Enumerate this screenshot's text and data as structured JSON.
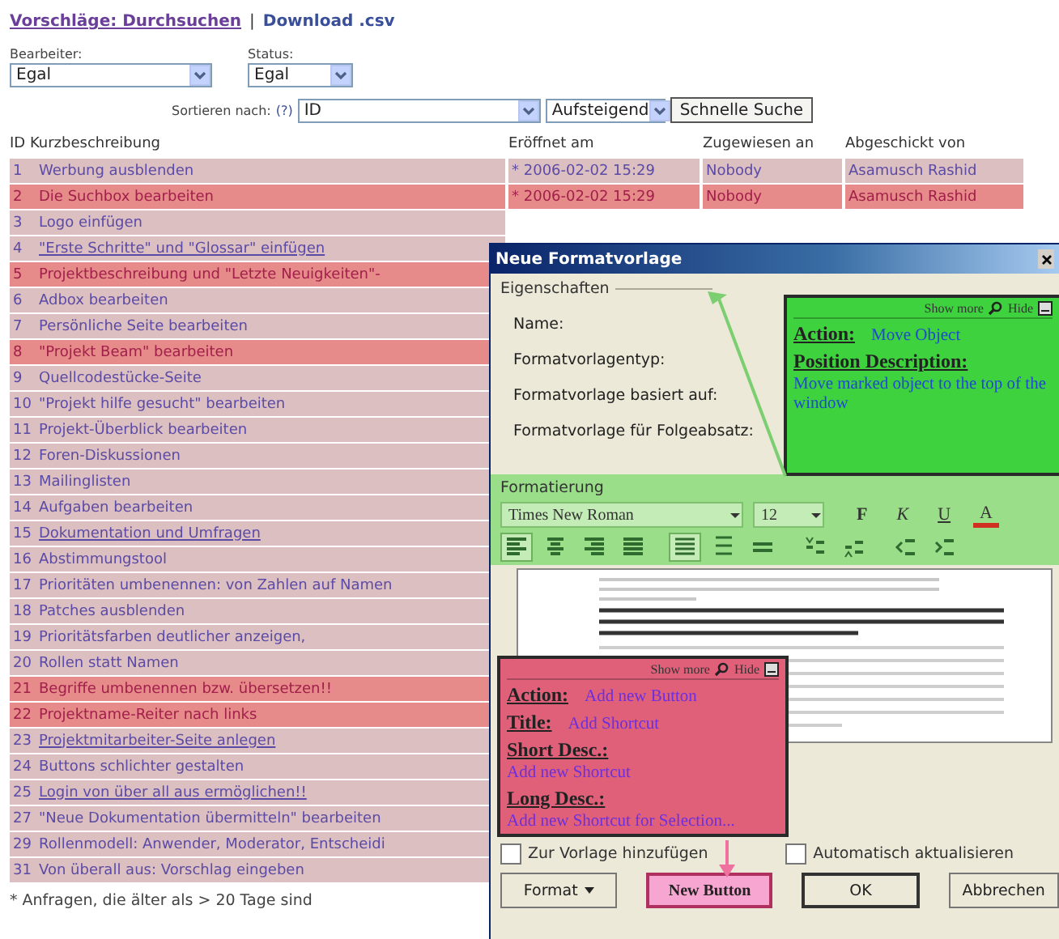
{
  "header": {
    "links": [
      {
        "label": "Vorschläge: Durchsuchen",
        "visited": true
      },
      {
        "label": "Download .csv",
        "visited": false
      }
    ],
    "separator": "|"
  },
  "filters": [
    {
      "label": "Bearbeiter:",
      "value": "Egal",
      "wide": true
    },
    {
      "label": "Status:",
      "value": "Egal",
      "wide": false
    }
  ],
  "sort": {
    "label": "Sortieren nach:",
    "help": "(?)",
    "field": "ID",
    "order": "Aufsteigend",
    "button": "Schnelle Suche"
  },
  "table": {
    "columns": [
      "ID",
      "Kurzbeschreibung",
      "Eröffnet am",
      "Zugewiesen an",
      "Abgeschickt von"
    ],
    "rows": [
      {
        "id": "1",
        "summary": "Werbung ausblenden",
        "opened": "* 2006-02-02 15:29",
        "assigned": "Nobody",
        "submitted_by": "Asamusch Rashid",
        "highlighted": false,
        "visited": false
      },
      {
        "id": "2",
        "summary": "Die Suchbox bearbeiten",
        "opened": "* 2006-02-02 15:29",
        "assigned": "Nobody",
        "submitted_by": "Asamusch Rashid",
        "highlighted": true,
        "visited": false
      },
      {
        "id": "3",
        "summary": "Logo einfügen",
        "highlighted": false,
        "visited": false
      },
      {
        "id": "4",
        "summary": "\"Erste Schritte\" und \"Glossar\" einfügen",
        "highlighted": false,
        "visited": true
      },
      {
        "id": "5",
        "summary": "Projektbeschreibung und \"Letzte Neuigkeiten\"-",
        "highlighted": true,
        "visited": false
      },
      {
        "id": "6",
        "summary": "Adbox bearbeiten",
        "highlighted": false,
        "visited": false
      },
      {
        "id": "7",
        "summary": "Persönliche Seite bearbeiten",
        "highlighted": false,
        "visited": false
      },
      {
        "id": "8",
        "summary": "\"Projekt Beam\" bearbeiten",
        "highlighted": true,
        "visited": false
      },
      {
        "id": "9",
        "summary": "Quellcodestücke-Seite",
        "highlighted": false,
        "visited": false
      },
      {
        "id": "10",
        "summary": "\"Projekt hilfe gesucht\" bearbeiten",
        "highlighted": false,
        "visited": false
      },
      {
        "id": "11",
        "summary": "Projekt-Überblick bearbeiten",
        "highlighted": false,
        "visited": false
      },
      {
        "id": "12",
        "summary": "Foren-Diskussionen",
        "highlighted": false,
        "visited": false
      },
      {
        "id": "13",
        "summary": "Mailinglisten",
        "highlighted": false,
        "visited": false
      },
      {
        "id": "14",
        "summary": "Aufgaben bearbeiten",
        "highlighted": false,
        "visited": false
      },
      {
        "id": "15",
        "summary": "Dokumentation und Umfragen",
        "highlighted": false,
        "visited": true
      },
      {
        "id": "16",
        "summary": "Abstimmungstool",
        "highlighted": false,
        "visited": false
      },
      {
        "id": "17",
        "summary": "Prioritäten umbenennen: von Zahlen auf Namen",
        "highlighted": false,
        "visited": false
      },
      {
        "id": "18",
        "summary": "Patches ausblenden",
        "highlighted": false,
        "visited": false
      },
      {
        "id": "19",
        "summary": "Prioritätsfarben deutlicher anzeigen,",
        "highlighted": false,
        "visited": false
      },
      {
        "id": "20",
        "summary": "Rollen statt Namen",
        "highlighted": false,
        "visited": false
      },
      {
        "id": "21",
        "summary": "Begriffe umbenennen bzw. übersetzen!!",
        "highlighted": true,
        "visited": false
      },
      {
        "id": "22",
        "summary": "Projektname-Reiter nach links",
        "highlighted": true,
        "visited": false
      },
      {
        "id": "23",
        "summary": "Projektmitarbeiter-Seite anlegen",
        "highlighted": false,
        "visited": true
      },
      {
        "id": "24",
        "summary": "Buttons schlichter gestalten",
        "highlighted": false,
        "visited": false
      },
      {
        "id": "25",
        "summary": "Login von über all aus ermöglichen!!",
        "highlighted": false,
        "visited": true
      },
      {
        "id": "27",
        "summary": "\"Neue Dokumentation übermitteln\" bearbeiten",
        "highlighted": false,
        "visited": false
      },
      {
        "id": "29",
        "summary": "Rollenmodell: Anwender, Moderator, Entscheidi",
        "highlighted": false,
        "visited": false
      },
      {
        "id": "31",
        "summary": "Von überall aus: Vorschlag eingeben",
        "highlighted": false,
        "visited": false
      }
    ]
  },
  "footnote": "* Anfragen, die älter als > 20 Tage sind",
  "dialog": {
    "title": "Neue Formatvorlage",
    "properties": {
      "legend": "Eigenschaften",
      "fields": [
        "Name:",
        "Formatvorlagentyp:",
        "Formatvorlage basiert auf:",
        "Formatvorlage für Folgeabsatz:"
      ]
    },
    "formatting": {
      "legend": "Formatierung",
      "font": "Times New Roman",
      "size": "12",
      "style_buttons": [
        {
          "label": "F",
          "kind": "bold"
        },
        {
          "label": "K",
          "kind": "italic"
        },
        {
          "label": "U",
          "kind": "underline"
        },
        {
          "label": "A",
          "kind": "color"
        }
      ],
      "paragraph_tools": [
        {
          "kind": "align-left",
          "selected": true
        },
        {
          "kind": "align-center",
          "selected": false
        },
        {
          "kind": "align-right",
          "selected": false
        },
        {
          "kind": "justify",
          "selected": false
        },
        {
          "kind": "single-spacing",
          "selected": true
        },
        {
          "kind": "one-half-spacing",
          "selected": false
        },
        {
          "kind": "double-spacing",
          "selected": false
        },
        {
          "kind": "space-before",
          "selected": false
        },
        {
          "kind": "space-after",
          "selected": false
        },
        {
          "kind": "indent-less",
          "selected": false
        },
        {
          "kind": "indent-more",
          "selected": false
        }
      ]
    },
    "checkboxes": [
      {
        "label": "Zur Vorlage hinzufügen",
        "checked": false
      },
      {
        "label": "Automatisch aktualisieren",
        "checked": false
      }
    ],
    "buttons": [
      {
        "label": "Format",
        "kind": "menu"
      },
      {
        "label": "New Button",
        "kind": "annotated"
      },
      {
        "label": "OK",
        "kind": "default"
      },
      {
        "label": "Abbrechen",
        "kind": "normal"
      }
    ]
  },
  "annotations": [
    {
      "kind": "upper",
      "color": "#3ed23e",
      "show_more": "Show more",
      "hide": "Hide",
      "entries": [
        {
          "label": "Action:",
          "value": "Move Object",
          "kind": "inline"
        },
        {
          "label": "Position Description:",
          "value": "Move marked object to the top of the window",
          "kind": "block"
        }
      ]
    },
    {
      "kind": "lower",
      "color": "#e0607a",
      "show_more": "Show more",
      "hide": "Hide",
      "entries": [
        {
          "label": "Action:",
          "value": "Add new Button",
          "kind": "inline"
        },
        {
          "label": "Title:",
          "value": "Add Shortcut",
          "kind": "inline"
        },
        {
          "label": "Short Desc.:",
          "value": "Add new Shortcut",
          "kind": "block"
        },
        {
          "label": "Long Desc.:",
          "value": "Add new Shortcut for Selection...",
          "kind": "block"
        }
      ]
    }
  ]
}
